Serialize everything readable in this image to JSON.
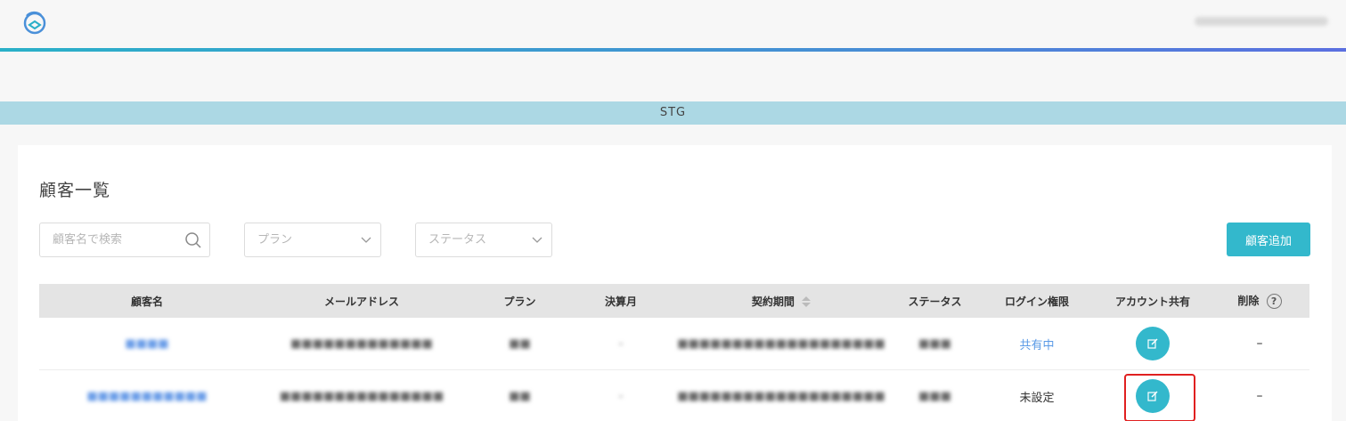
{
  "env": {
    "label": "STG"
  },
  "page": {
    "title": "顧客一覧"
  },
  "filters": {
    "search_placeholder": "顧客名で検索",
    "plan_placeholder": "プラン",
    "status_placeholder": "ステータス"
  },
  "actions": {
    "add_customer": "顧客追加"
  },
  "table": {
    "headers": {
      "name": "顧客名",
      "email": "メールアドレス",
      "plan": "プラン",
      "billing_month": "決算月",
      "contract_period": "契約期間",
      "status": "ステータス",
      "login_permission": "ログイン権限",
      "account_share": "アカウント共有",
      "delete": "削除",
      "delete_help": "?"
    },
    "rows": [
      {
        "name": "",
        "email": "",
        "plan": "",
        "billing_month": "",
        "contract_period": "",
        "status": "",
        "login_permission": "共有中",
        "delete": "–"
      },
      {
        "name": "",
        "email": "",
        "plan": "",
        "billing_month": "",
        "contract_period": "",
        "status": "",
        "login_permission": "未設定",
        "delete": "–"
      }
    ]
  },
  "colors": {
    "accent": "#33b8cc",
    "link": "#5a9ae6",
    "banner": "#acd8e4",
    "header_bg": "#e4e4e4",
    "highlight": "#e02020"
  }
}
